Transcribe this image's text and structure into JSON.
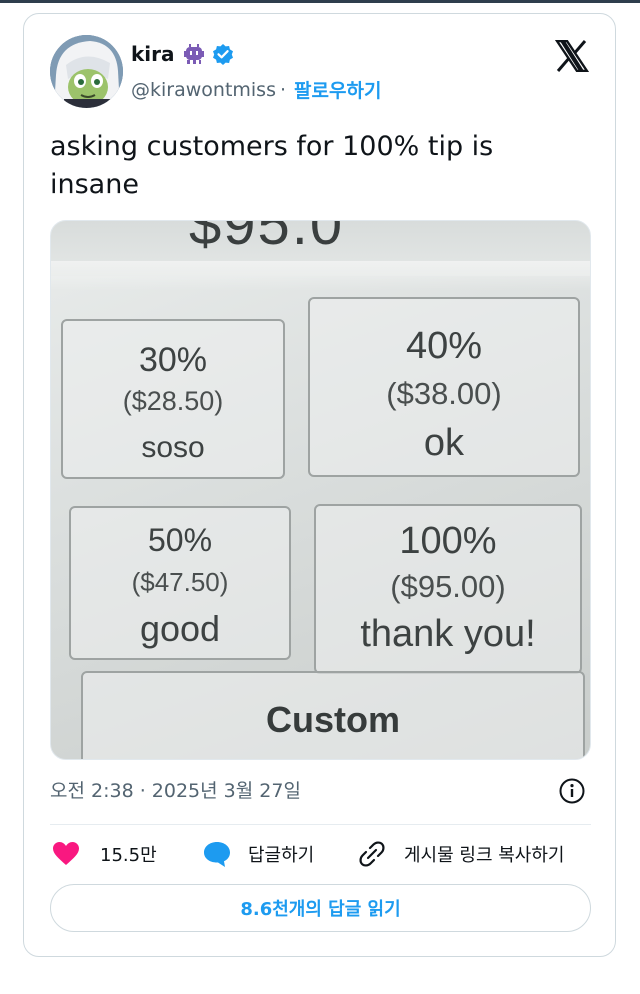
{
  "tweet": {
    "author": {
      "name": "kira",
      "handle": "@kirawontmiss",
      "follow_label": "팔로우하기",
      "separator": "·"
    },
    "text": "asking customers for 100% tip is insane",
    "timestamp": "오전 2:38 · 2025년 3월 27일",
    "actions": {
      "likes": "15.5만",
      "reply_label": "답글하기",
      "copy_link_label": "게시물 링크 복사하기"
    },
    "read_replies_label": "8.6천개의 답글 읽기"
  },
  "photo": {
    "top_amount_fragment": "$95.0",
    "tips": [
      {
        "percent": "30%",
        "amount": "($28.50)",
        "label": "soso"
      },
      {
        "percent": "40%",
        "amount": "($38.00)",
        "label": "ok"
      },
      {
        "percent": "50%",
        "amount": "($47.50)",
        "label": "good"
      },
      {
        "percent": "100%",
        "amount": "($95.00)",
        "label": "thank you!"
      }
    ],
    "custom_label": "Custom"
  },
  "colors": {
    "accent": "#1d9bf0",
    "like": "#f91880",
    "text": "#0f1419",
    "muted": "#536471"
  },
  "icons": [
    "ghost-emoji-icon",
    "verified-badge-icon",
    "x-logo-icon",
    "info-icon",
    "heart-icon",
    "reply-bubble-icon",
    "link-icon"
  ]
}
